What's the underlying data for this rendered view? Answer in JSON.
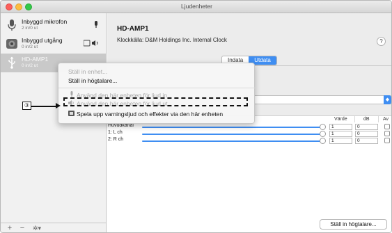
{
  "window": {
    "title": "Ljudenheter"
  },
  "sidebar": {
    "devices": [
      {
        "name": "Inbyggd mikrofon",
        "io": "2 in/0 ut",
        "icon": "microphone-icon",
        "badge": "mic-badge-icon"
      },
      {
        "name": "Inbyggd utgång",
        "io": "0 in/2 ut",
        "icon": "speaker-icon",
        "badge": "output-badge-icon"
      },
      {
        "name": "HD-AMP1",
        "io": "0 in/2 ut",
        "icon": "usb-icon"
      }
    ],
    "bottom": {
      "add": "+",
      "remove": "−",
      "settings": "✲▾"
    }
  },
  "main": {
    "device_title": "HD-AMP1",
    "clock_label": "Klockkälla:",
    "clock_value": "D&M Holdings Inc. Internal Clock",
    "help": "?",
    "tabs": [
      {
        "label": "Indata",
        "active": false
      },
      {
        "label": "Utdata",
        "active": true
      }
    ],
    "table": {
      "headers": {
        "value": "Värde",
        "db": "dB",
        "mute": "Av"
      },
      "rows": [
        {
          "label": "Huvudkanal",
          "value": "1",
          "db": "0"
        },
        {
          "label": "1: L ch",
          "value": "1",
          "db": "0"
        },
        {
          "label": "2: R ch",
          "value": "1",
          "db": "0"
        }
      ]
    },
    "speaker_button": "Ställ in högtalare..."
  },
  "context_menu": {
    "items": [
      {
        "label": "Ställ in enhet...",
        "enabled": false
      },
      {
        "label": "Ställ in högtalare...",
        "enabled": true
      },
      {
        "label": "Använd den här enheten för ljud in",
        "enabled": false,
        "icon": "microphone-icon"
      },
      {
        "label": "Använd den här enheten för ljud ut",
        "enabled": false,
        "icon": "speaker-icon",
        "highlighted": true
      },
      {
        "label": "Spela upp varningsljud och effekter via den här enheten",
        "enabled": true,
        "icon": "alert-icon"
      }
    ]
  },
  "callout": {
    "number": "③"
  },
  "colors": {
    "accent": "#3f8ef2",
    "highlight_border": "#111111"
  }
}
